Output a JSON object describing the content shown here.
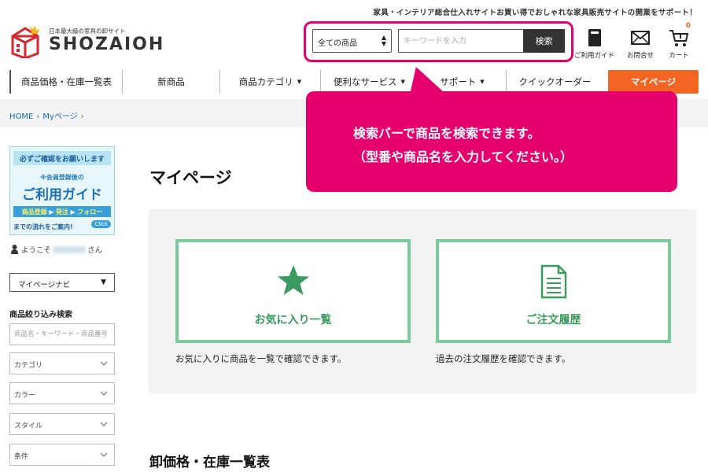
{
  "header": {
    "tagline": "家具・インテリア総合仕入れサイトお買い得でおしゃれな家具販売サイトの開業をサポート！",
    "logo_sub": "日本最大級の家具の卸サイト",
    "logo_main": "SHOZAIOH"
  },
  "search": {
    "category_selected": "全ての商品",
    "placeholder": "キーワードを入力",
    "button_label": "検索"
  },
  "header_icons": {
    "guide_label": "ご利用ガイド",
    "contact_label": "お問合せ",
    "cart_label": "カート",
    "cart_count": "0"
  },
  "nav": {
    "items": [
      {
        "label": "商品価格・在庫一覧表",
        "caret": ""
      },
      {
        "label": "新商品",
        "caret": ""
      },
      {
        "label": "商品カテゴリ",
        "caret": "▼"
      },
      {
        "label": "便利なサービス",
        "caret": "▼"
      },
      {
        "label": "サポート",
        "caret": "▼"
      },
      {
        "label": "クイックオーダー",
        "caret": ""
      }
    ],
    "mypage_label": "マイページ"
  },
  "breadcrumb": {
    "home": "HOME",
    "current": "Myページ",
    "sep": "›"
  },
  "callout": {
    "line1": "検索バーで商品を検索できます。",
    "line2": "（型番や商品名を入力してください。）"
  },
  "sidebar": {
    "banner": {
      "top": "必ずご確認をお願いします",
      "small": "※会員登録後の",
      "title": "ご利用ガイド",
      "step1": "商品登録",
      "arrow": "▶",
      "step2": "発注",
      "step3": "フォロー",
      "foot": "までの流れをご案内!",
      "click": "Click"
    },
    "welcome_prefix": "ようこそ",
    "welcome_suffix": "さん",
    "mypage_nav": "マイページナビ",
    "filter_heading": "商品絞り込み検索",
    "filter_placeholder": "商品名・キーワード・商品番号",
    "filters": [
      "カテゴリ",
      "カラー",
      "スタイル",
      "条件"
    ]
  },
  "main": {
    "page_title": "マイページ",
    "cards": [
      {
        "label": "お気に入り一覧",
        "desc": "お気に入りに商品を一覧で確認できます。"
      },
      {
        "label": "ご注文履歴",
        "desc": "過去の注文履歴を確認できます。"
      }
    ],
    "section_title": "卸価格・在庫一覧表"
  },
  "colors": {
    "accent": "#f26522",
    "highlight": "#e5006e",
    "card_green": "#7cc99b",
    "link": "#1a6ab8"
  }
}
